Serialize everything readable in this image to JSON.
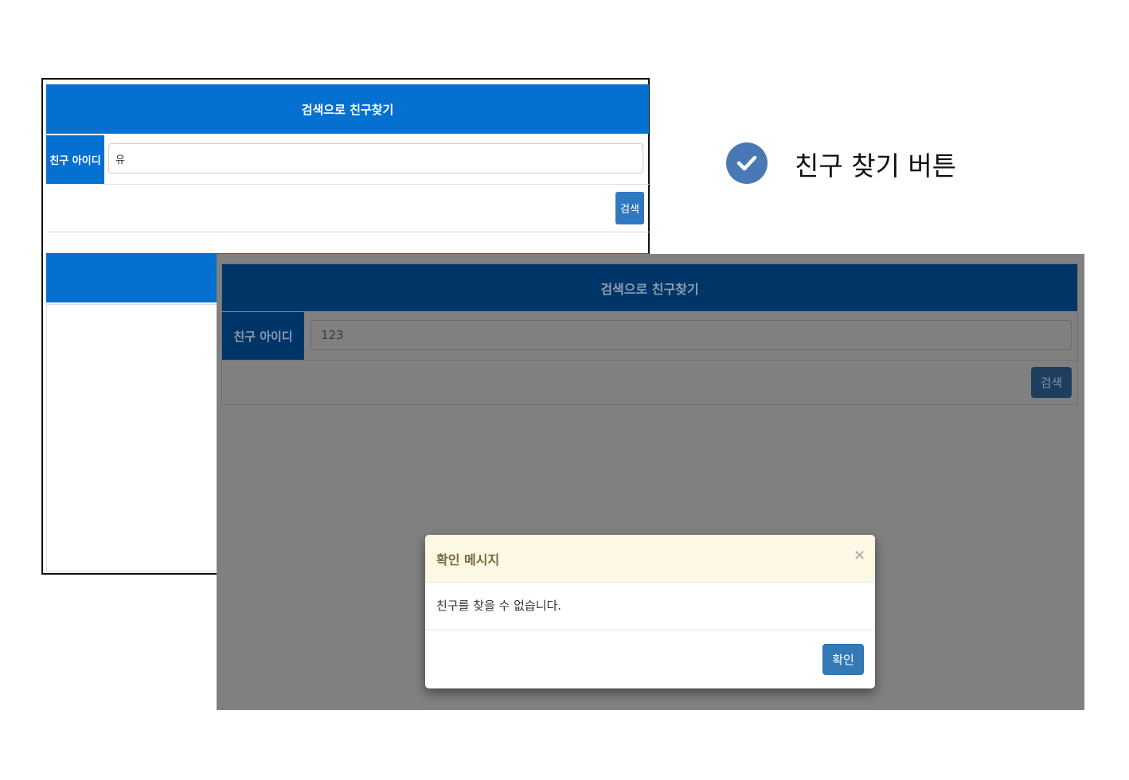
{
  "back_window": {
    "header_title": "검색으로 친구찾기",
    "field_label": "친구 아이디",
    "input_value": "유",
    "search_button": "검색"
  },
  "annotation": {
    "label": "친구 찾기 버튼",
    "icon": "check-circle-icon"
  },
  "front_window": {
    "header_title": "검색으로 친구찾기",
    "field_label": "친구 아이디",
    "input_value": "123",
    "search_button": "검색"
  },
  "modal": {
    "title": "확인 메시지",
    "close_glyph": "×",
    "message": "친구를 찾을 수 없습니다.",
    "confirm_button": "확인"
  },
  "colors": {
    "header_blue": "#0470d0",
    "button_blue": "#337ab7",
    "overlay": "#808080",
    "modal_header": "#fdf8e4",
    "check_circle": "#4a78b4"
  }
}
